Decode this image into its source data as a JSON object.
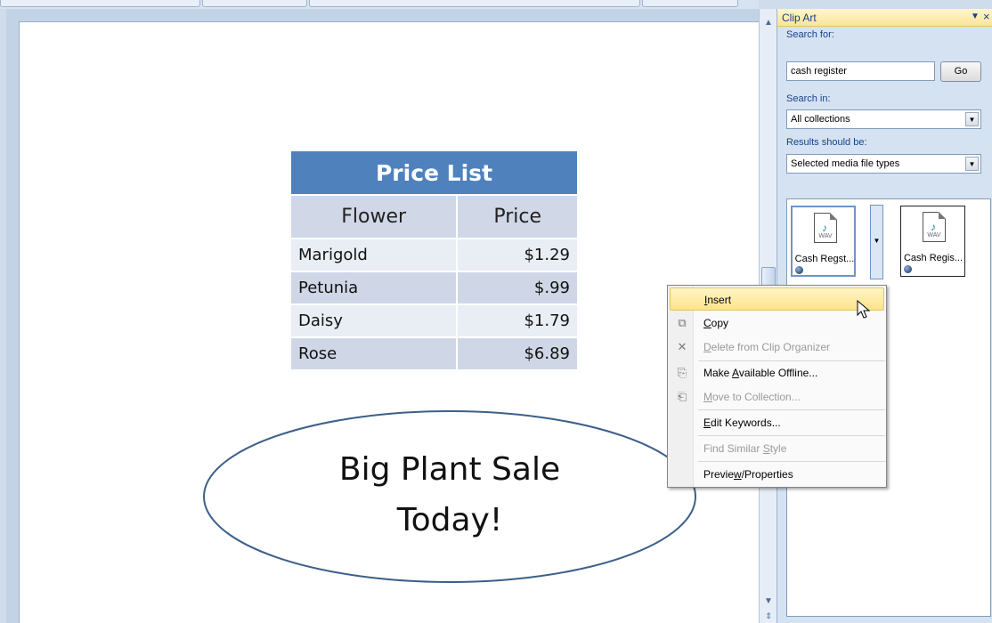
{
  "slide": {
    "table": {
      "title": "Price List",
      "headers": [
        "Flower",
        "Price"
      ],
      "rows": [
        {
          "flower": "Marigold",
          "price": "$1.29"
        },
        {
          "flower": "Petunia",
          "price": "$.99"
        },
        {
          "flower": "Daisy",
          "price": "$1.79"
        },
        {
          "flower": "Rose",
          "price": "$6.89"
        }
      ]
    },
    "callout": {
      "line1": "Big Plant Sale",
      "line2": "Today!"
    }
  },
  "pane": {
    "title": "Clip Art",
    "search_for_label": "Search for:",
    "search_value": "cash register",
    "go_label": "Go",
    "search_in_label": "Search in:",
    "search_in_value": "All collections",
    "results_label": "Results should be:",
    "results_value": "Selected media file types",
    "clips": [
      {
        "label": "Cash Regst...",
        "type": "WAV"
      },
      {
        "label": "Cash Regis...",
        "type": "WAV"
      }
    ]
  },
  "context_menu": {
    "items": [
      {
        "label": "Insert",
        "disabled": false,
        "icon": ""
      },
      {
        "label": "Copy",
        "disabled": false,
        "icon": "copy-icon"
      },
      {
        "label": "Delete from Clip Organizer",
        "disabled": true,
        "icon": "delete-icon"
      },
      {
        "label": "Make Available Offline...",
        "disabled": false,
        "icon": "offline-icon"
      },
      {
        "label": "Move to Collection...",
        "disabled": true,
        "icon": "move-icon"
      },
      {
        "label": "Edit Keywords...",
        "disabled": false,
        "icon": ""
      },
      {
        "label": "Find Similar Style",
        "disabled": true,
        "icon": ""
      },
      {
        "label": "Preview/Properties",
        "disabled": false,
        "icon": ""
      }
    ]
  },
  "colors": {
    "table_header": "#4f81bd",
    "table_row_dark": "#cfd7e7",
    "table_row_light": "#e9edf4",
    "menu_highlight": "#fde38a",
    "pane_text": "#15428b"
  }
}
